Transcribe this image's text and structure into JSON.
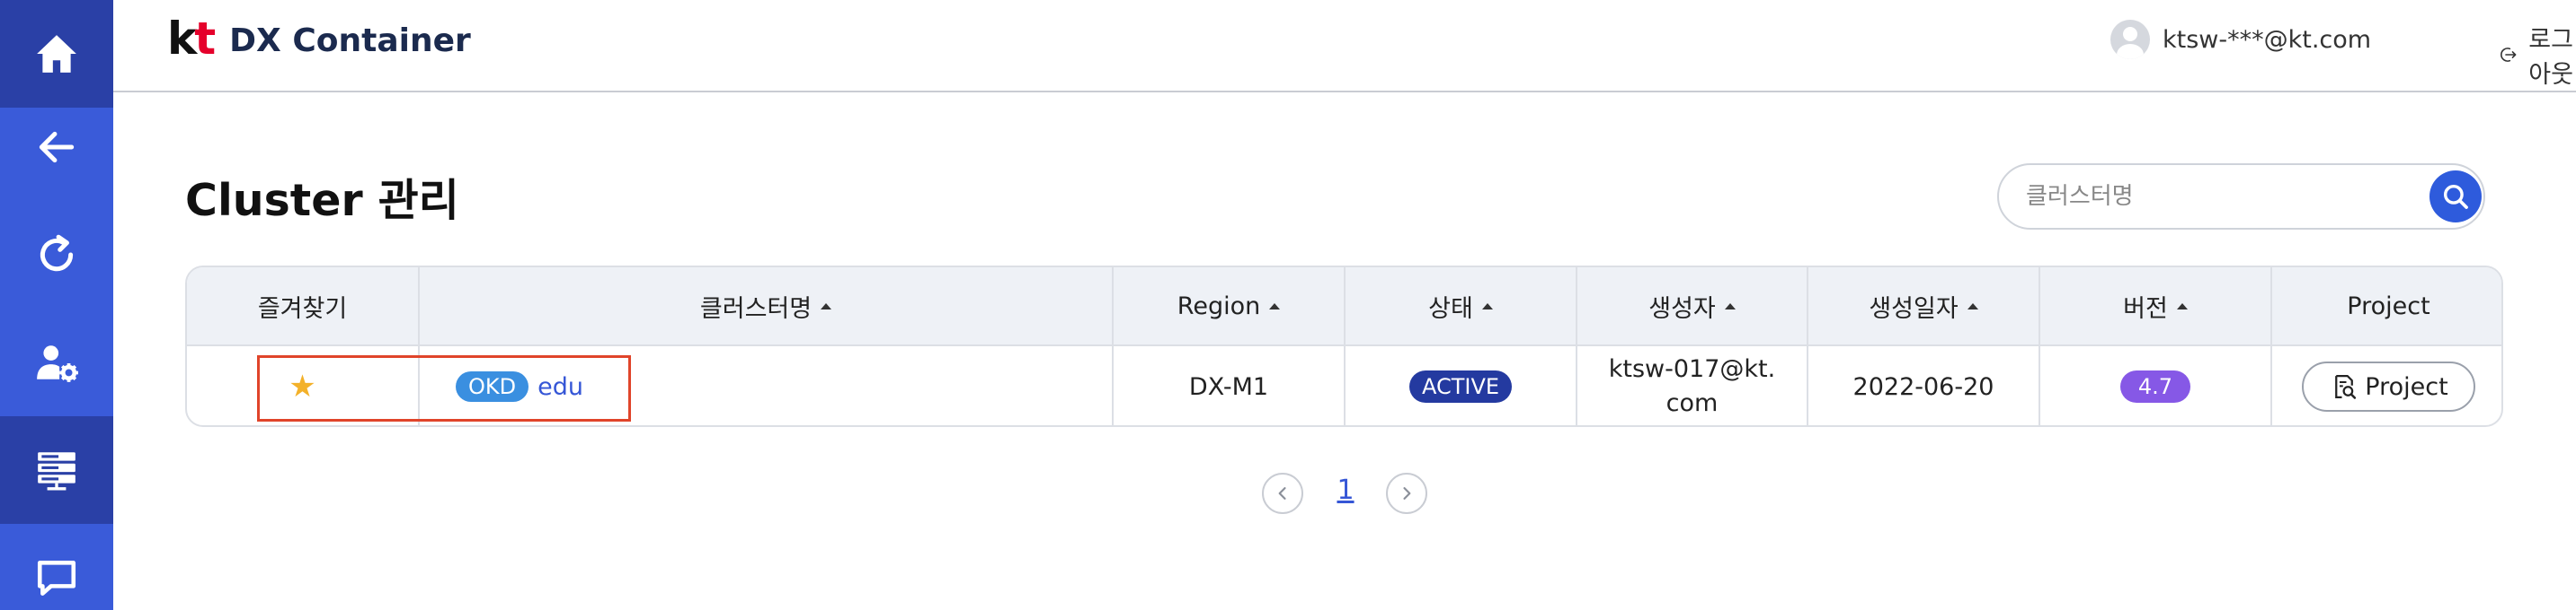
{
  "sidebar": {
    "items": [
      {
        "name": "home",
        "icon": "home-icon"
      },
      {
        "name": "back",
        "icon": "arrow-left-icon"
      },
      {
        "name": "refresh",
        "icon": "refresh-icon"
      },
      {
        "name": "user-settings",
        "icon": "user-gear-icon"
      },
      {
        "name": "cluster",
        "icon": "server-icon",
        "active": true
      },
      {
        "name": "chat",
        "icon": "chat-icon"
      }
    ]
  },
  "header": {
    "logo_kt": "kt",
    "logo_text": "DX Container",
    "user_email": "ktsw-***@kt.com",
    "logout_label": "로그아웃"
  },
  "page": {
    "title": "Cluster 관리"
  },
  "search": {
    "placeholder": "클러스터명"
  },
  "table": {
    "headers": {
      "favorite": "즐겨찾기",
      "name": "클러스터명",
      "region": "Region",
      "status": "상태",
      "creator": "생성자",
      "created": "생성일자",
      "version": "버전",
      "project": "Project"
    },
    "rows": [
      {
        "favorite": "★",
        "type": "OKD",
        "name": "edu",
        "region": "DX-M1",
        "status": "ACTIVE",
        "creator": "ktsw-017@kt.com",
        "created": "2022-06-20",
        "version": "4.7",
        "project_button": "Project"
      }
    ]
  },
  "pagination": {
    "current_page": "1"
  },
  "colors": {
    "sidebar": "#3a5bd9",
    "sidebar_active": "#2a40a6",
    "accent": "#2e5bdc",
    "okd_badge": "#3a8fe0",
    "active_badge": "#243aa0",
    "version_badge": "#8658e6",
    "highlight_box": "#e0442a",
    "star": "#f3b12a"
  }
}
